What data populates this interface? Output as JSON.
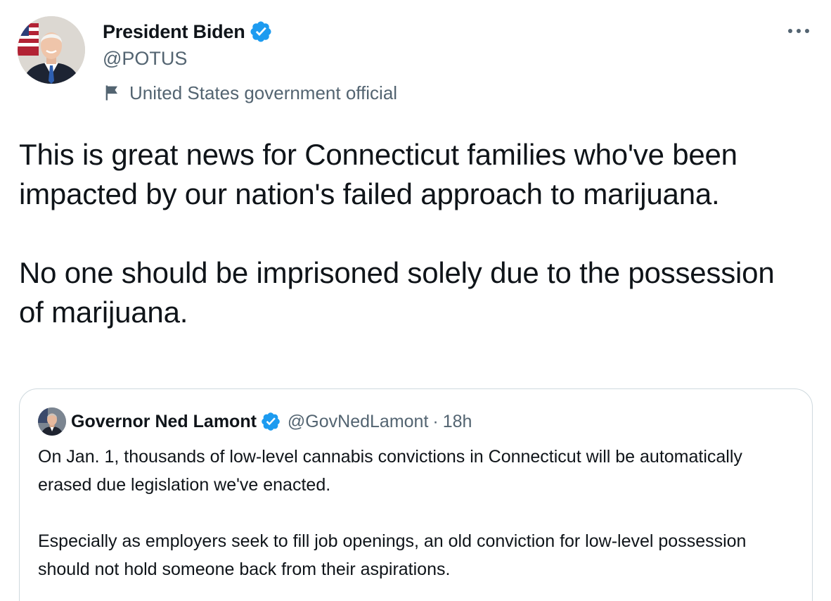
{
  "author": {
    "display_name": "President Biden",
    "handle": "@POTUS",
    "label": "United States government official",
    "verified": true,
    "avatar_icon": "avatar-photo-icon",
    "verified_icon": "verified-badge-icon",
    "label_icon": "flag-icon"
  },
  "menu": {
    "more_icon": "more-options-icon"
  },
  "tweet": {
    "paragraphs": [
      "This is great news for Connecticut families who've been impacted by our nation's failed approach to marijuana.",
      "No one should be imprisoned solely due to the possession of marijuana."
    ]
  },
  "quoted": {
    "display_name": "Governor Ned Lamont",
    "handle": "@GovNedLamont",
    "separator": "·",
    "time": "18h",
    "verified": true,
    "paragraphs": [
      "On Jan. 1, thousands of low-level cannabis convictions in Connecticut will be automatically erased due legislation we've enacted.",
      "Especially as employers seek to fill job openings, an old conviction for low-level possession should not hold someone back from their aspirations."
    ]
  },
  "colors": {
    "text_primary": "#0f1419",
    "text_secondary": "#536471",
    "verified_blue": "#1d9bf0",
    "border": "#cfd9de"
  }
}
